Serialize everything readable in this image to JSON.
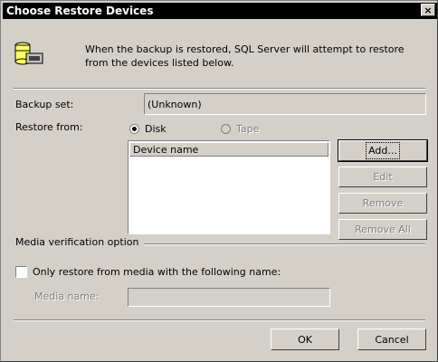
{
  "window": {
    "title": "Choose Restore Devices",
    "close_glyph": "×"
  },
  "header": {
    "icon": "database-tape-icon",
    "text": "When the backup is restored, SQL Server will attempt to restore from the devices listed below."
  },
  "backup_set": {
    "label": "Backup set:",
    "value": "(Unknown)"
  },
  "restore_from": {
    "label": "Restore from:",
    "options": [
      {
        "label": "Disk",
        "selected": true,
        "enabled": true
      },
      {
        "label": "Tape",
        "selected": false,
        "enabled": false
      }
    ]
  },
  "devices": {
    "column_header": "Device name",
    "rows": []
  },
  "side_buttons": {
    "add": "Add...",
    "edit": "Edit",
    "remove": "Remove",
    "remove_all": "Remove All"
  },
  "media_verification": {
    "label": "Media verification option",
    "only_restore_label": "Only restore from media with the following name:",
    "only_restore_checked": false,
    "media_name_label": "Media name:",
    "media_name_value": ""
  },
  "footer": {
    "ok": "OK",
    "cancel": "Cancel"
  }
}
